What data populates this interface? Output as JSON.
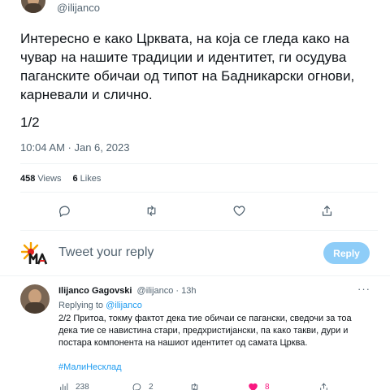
{
  "tweet": {
    "handle": "@ilijanco",
    "text": "Интересно е како Црквата, на која се гледа како на чувар на нашите традиции и идентитет, ги осудува паганските обичаи од типот на Бадникарски огнови, карневали и слично.",
    "part": "1/2",
    "time": "10:04 AM · Jan 6, 2023",
    "views_count": "458",
    "views_label": "Views",
    "likes_count": "6",
    "likes_label": "Likes"
  },
  "icons": {
    "reply": "reply-icon",
    "retweet": "retweet-icon",
    "like": "heart-icon",
    "share": "share-icon"
  },
  "compose": {
    "placeholder": "Tweet your reply",
    "button_label": "Reply"
  },
  "reply": {
    "name": "Ilijanco Gagovski",
    "handle": "@ilijanco",
    "time": "· 13h",
    "more": "···",
    "replying_prefix": "Replying to",
    "replying_to": "@ilijanco",
    "text": "2/2 Притоа, токму фактот дека тие обичаи се пагански, сведочи за тоа дека тие се навистина стари, предхристијански, па како такви, дури и постара компонента на нашиот идентитет од самата Црква.",
    "hashtag": "#МалиНесклад",
    "actions": {
      "views": "238",
      "replies": "2",
      "retweets": "",
      "likes": "8"
    }
  },
  "colors": {
    "accent": "#1d9bf0",
    "reply_button": "#8ecdf8",
    "like": "#f91880",
    "muted": "#536471"
  }
}
